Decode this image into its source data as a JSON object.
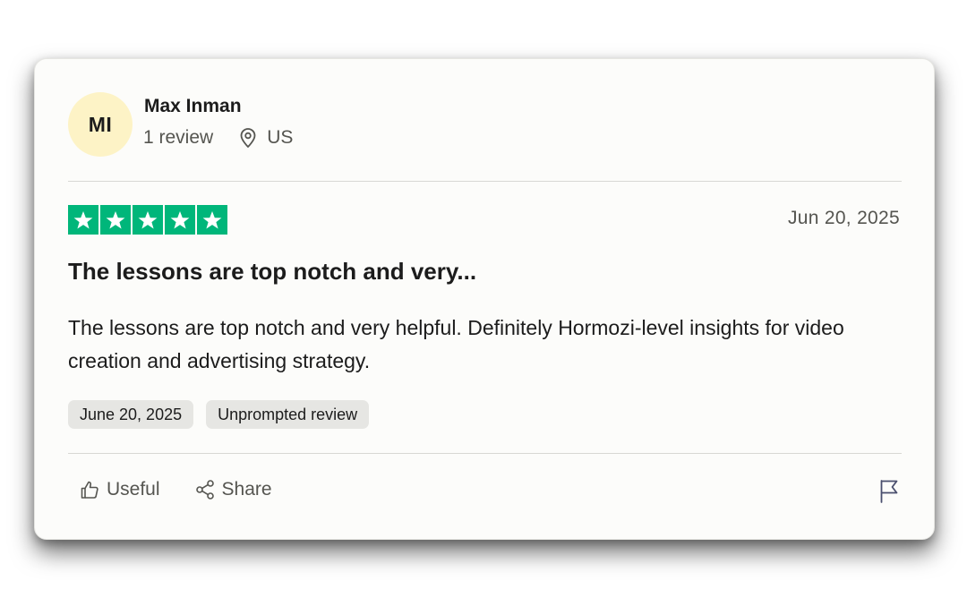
{
  "reviewer": {
    "initials": "MI",
    "name": "Max Inman",
    "review_count": "1 review",
    "country": "US"
  },
  "review": {
    "rating": 5,
    "date_short": "Jun 20, 2025",
    "title": "The lessons are top notch and very...",
    "body": "The lessons are top notch and very helpful. Definitely Hormozi-level insights for video creation and advertising strategy.",
    "tags": [
      "June 20, 2025",
      "Unprompted review"
    ]
  },
  "actions": {
    "useful_label": "Useful",
    "share_label": "Share"
  },
  "icons": {
    "location": "location-pin-icon",
    "star": "star-icon",
    "thumbs_up": "thumbs-up-icon",
    "share": "share-icon",
    "flag": "flag-icon"
  },
  "colors": {
    "star_green": "#00b67a",
    "avatar_bg": "#fdf3c6",
    "card_bg": "#fcfcfa",
    "chip_bg": "#e6e6e3"
  }
}
